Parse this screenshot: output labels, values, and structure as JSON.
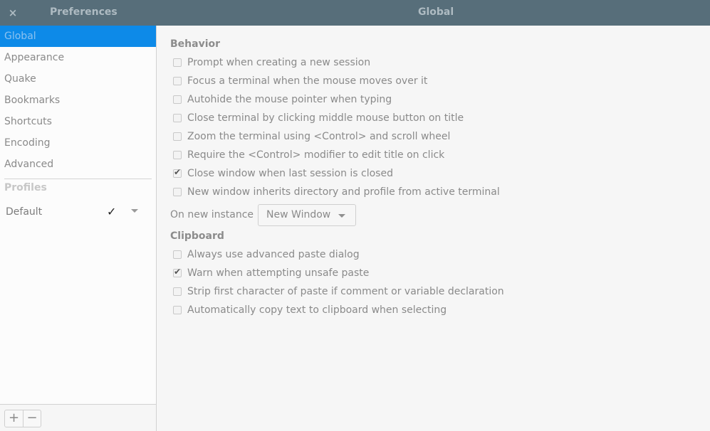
{
  "window": {
    "sidebar_title": "Preferences",
    "main_title": "Global",
    "close_glyph": "×"
  },
  "sidebar": {
    "items": [
      {
        "label": "Global",
        "active": true
      },
      {
        "label": "Appearance",
        "active": false
      },
      {
        "label": "Quake",
        "active": false
      },
      {
        "label": "Bookmarks",
        "active": false
      },
      {
        "label": "Shortcuts",
        "active": false
      },
      {
        "label": "Encoding",
        "active": false
      },
      {
        "label": "Advanced",
        "active": false
      }
    ],
    "profiles_heading": "Profiles",
    "profiles": [
      {
        "name": "Default",
        "is_default": true,
        "check_glyph": "✓"
      }
    ],
    "add_label": "+",
    "remove_label": "−"
  },
  "behavior": {
    "heading": "Behavior",
    "options": [
      {
        "label": "Prompt when creating a new session",
        "checked": false
      },
      {
        "label": "Focus a terminal when the mouse moves over it",
        "checked": false
      },
      {
        "label": "Autohide the mouse pointer when typing",
        "checked": false
      },
      {
        "label": "Close terminal by clicking middle mouse button on title",
        "checked": false
      },
      {
        "label": "Zoom the terminal using <Control> and scroll wheel",
        "checked": false
      },
      {
        "label": "Require the <Control> modifier to edit title on click",
        "checked": false
      },
      {
        "label": "Close window when last session is closed",
        "checked": true
      },
      {
        "label": "New window inherits directory and profile from active terminal",
        "checked": false
      }
    ],
    "on_new_instance_label": "On new instance",
    "on_new_instance_value": "New Window"
  },
  "clipboard": {
    "heading": "Clipboard",
    "options": [
      {
        "label": "Always use advanced paste dialog",
        "checked": false
      },
      {
        "label": "Warn when attempting unsafe paste",
        "checked": true
      },
      {
        "label": "Strip first character of paste if comment or variable declaration",
        "checked": false
      },
      {
        "label": "Automatically copy text to clipboard when selecting",
        "checked": false
      }
    ]
  }
}
